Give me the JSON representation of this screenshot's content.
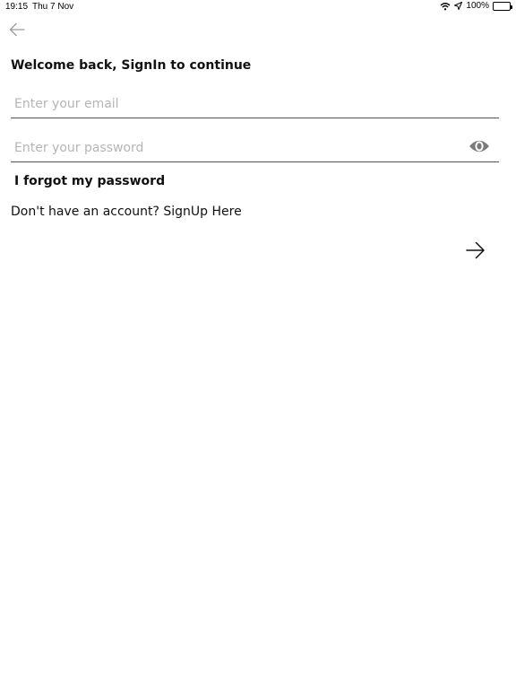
{
  "status_bar": {
    "time": "19:15",
    "date": "Thu 7 Nov",
    "battery": "100%",
    "icons": [
      "wifi-icon",
      "location-icon",
      "battery-icon"
    ]
  },
  "nav": {
    "back_icon": "arrow-left-icon"
  },
  "login": {
    "heading": "Welcome back, SignIn to continue",
    "email_placeholder": "Enter your email",
    "email_value": "",
    "password_placeholder": "Enter your password",
    "password_value": "",
    "password_toggle_icon": "eye-icon",
    "forgot_password": "I forgot my password",
    "signup_prompt": "Don't have an account? SignUp Here",
    "submit_icon": "arrow-right-icon"
  },
  "colors": {
    "text": "#111111",
    "placeholder": "#b5b5b5",
    "underline": "#555555",
    "back_arrow": "#9a9a9a",
    "eye_icon": "#7a7a7a"
  }
}
